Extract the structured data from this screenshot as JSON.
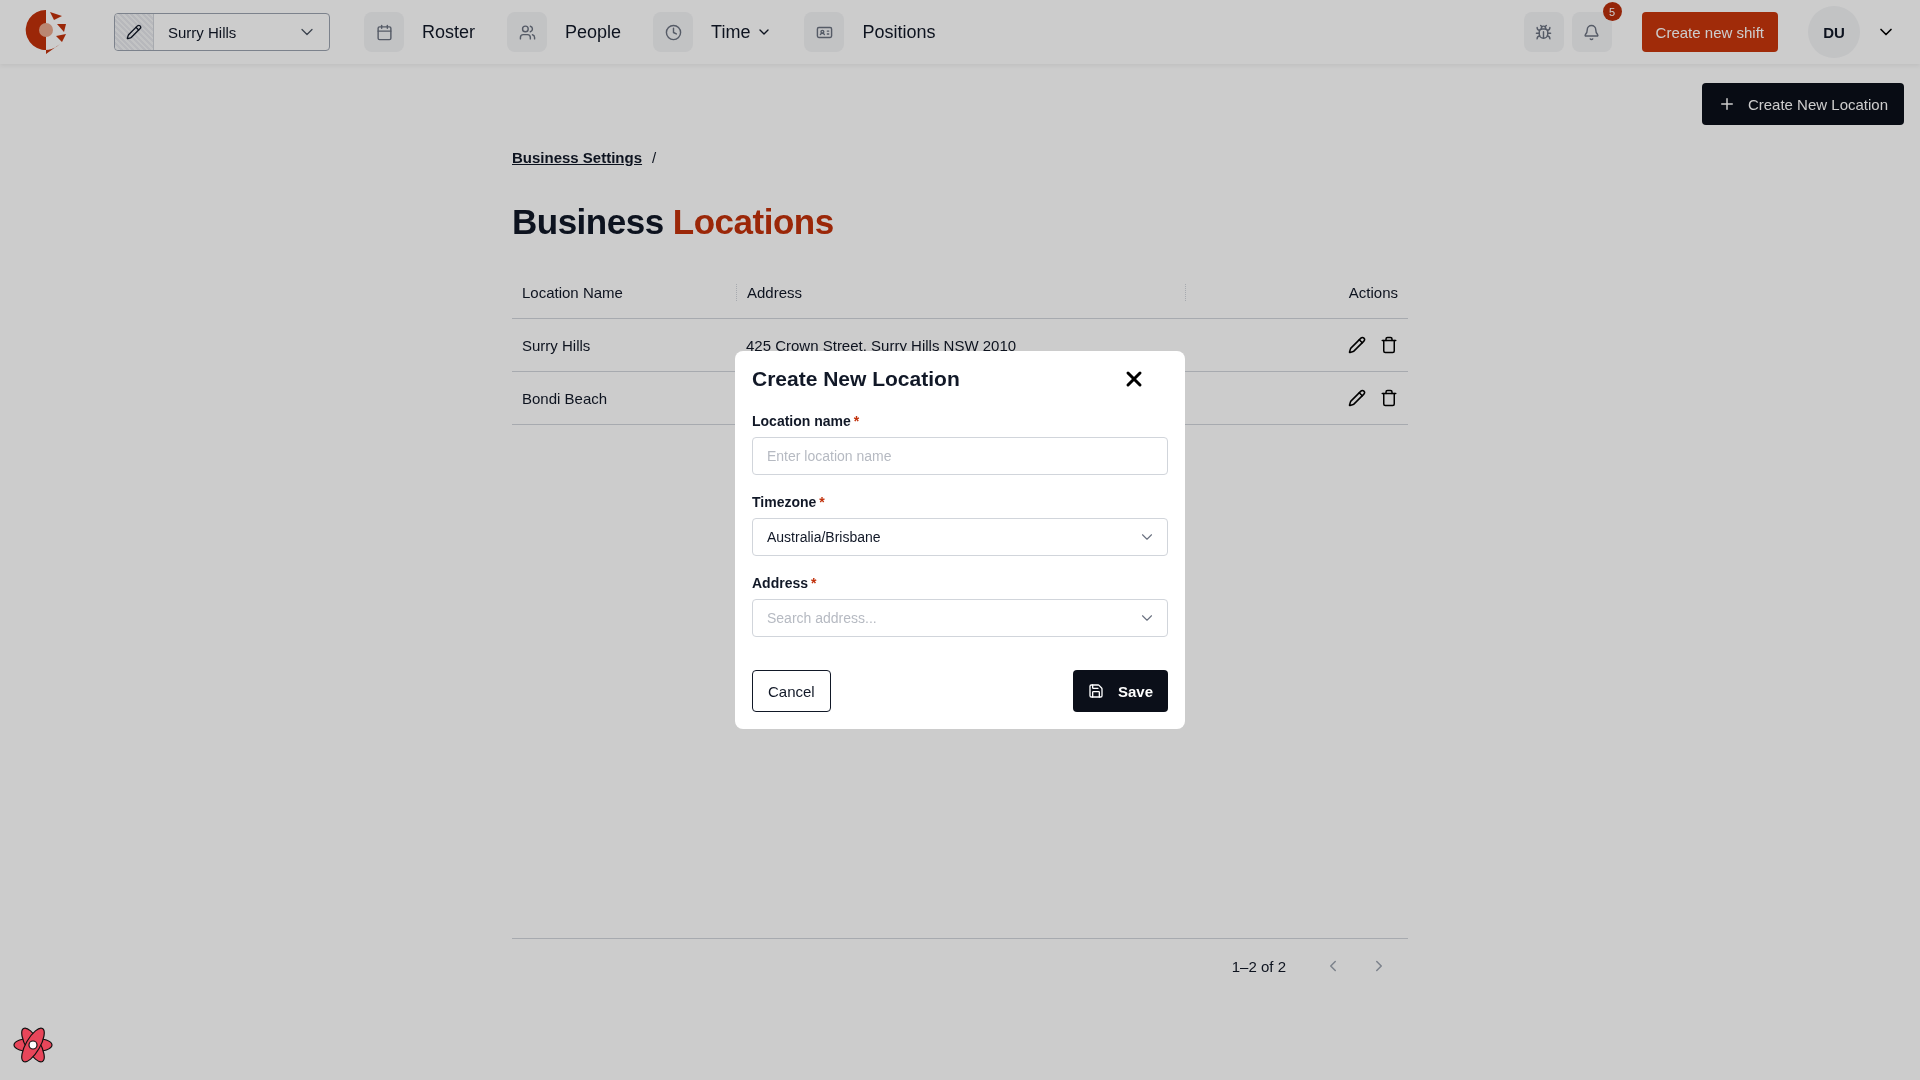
{
  "nav": {
    "location_selector": {
      "value": "Surry Hills"
    },
    "items": [
      {
        "label": "Roster",
        "dropdown": false
      },
      {
        "label": "People",
        "dropdown": false
      },
      {
        "label": "Time",
        "dropdown": true
      },
      {
        "label": "Positions",
        "dropdown": false
      }
    ],
    "notifications": {
      "count": "5"
    },
    "create_shift_button": "Create new shift",
    "avatar": {
      "initials": "DU"
    }
  },
  "create_location_button": "Create New Location",
  "breadcrumb": [
    {
      "label": "Business Settings",
      "separator": "/"
    }
  ],
  "title": {
    "text": "Business",
    "highlight": "Locations"
  },
  "table": {
    "columns": [
      "Location Name",
      "Address",
      "Actions"
    ],
    "rows": [
      {
        "name": "Surry Hills",
        "address": "425 Crown Street, Surry Hills NSW 2010"
      },
      {
        "name": "Bondi Beach"
      }
    ]
  },
  "pagination": {
    "range": "1–2 of 2",
    "prev": {
      "disabled": true
    },
    "next": {
      "disabled": true
    }
  },
  "modal": {
    "title": "Create New Location",
    "fields": [
      {
        "kind": "text",
        "label": "Location name",
        "required_mark": "*",
        "placeholder": "Enter location name"
      },
      {
        "kind": "select",
        "label": "Timezone",
        "required_mark": "*",
        "value": "Australia/Brisbane"
      },
      {
        "kind": "search",
        "label": "Address",
        "required_mark": "*",
        "placeholder": "Search address..."
      }
    ],
    "buttons": [
      {
        "kind": "secondary",
        "label": "Cancel"
      },
      {
        "kind": "primary",
        "label": "Save"
      }
    ]
  }
}
